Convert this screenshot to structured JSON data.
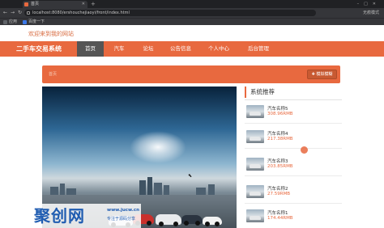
{
  "browser": {
    "tab_title": "首页",
    "url": "localhost:8080/ershouchejiaoyi/front/index.html",
    "profile": "无痕模式",
    "bookmarks": [
      "应用",
      "百度一下"
    ],
    "nav_glyphs": "←→↻",
    "new_tab_glyph": "+",
    "window_controls": "–□✕",
    "close_glyph": "✕"
  },
  "header": {
    "welcome": "欢迎来到我的网站",
    "brand": "二手车交易系统",
    "nav": [
      "首页",
      "汽车",
      "论坛",
      "公告信息",
      "个人中心",
      "后台管理"
    ],
    "active_index": 0
  },
  "banner": {
    "breadcrumb": "首页",
    "action_label": "✚ 模拟模糊",
    "accent_color": "#e8693f"
  },
  "watermark": {
    "logo": "聚创网",
    "url": "www.jucw.cn",
    "tagline": "专注于源码分享"
  },
  "sidebar": {
    "title": "系统推荐",
    "items": [
      {
        "name": "汽车名称5",
        "price": "308.96RMB"
      },
      {
        "name": "汽车名称4",
        "price": "217.38RMB"
      },
      {
        "name": "汽车名称3",
        "price": "203.85RMB"
      },
      {
        "name": "汽车名称2",
        "price": "27.59RMB"
      },
      {
        "name": "汽车名称1",
        "price": "174.44RMB"
      }
    ]
  }
}
